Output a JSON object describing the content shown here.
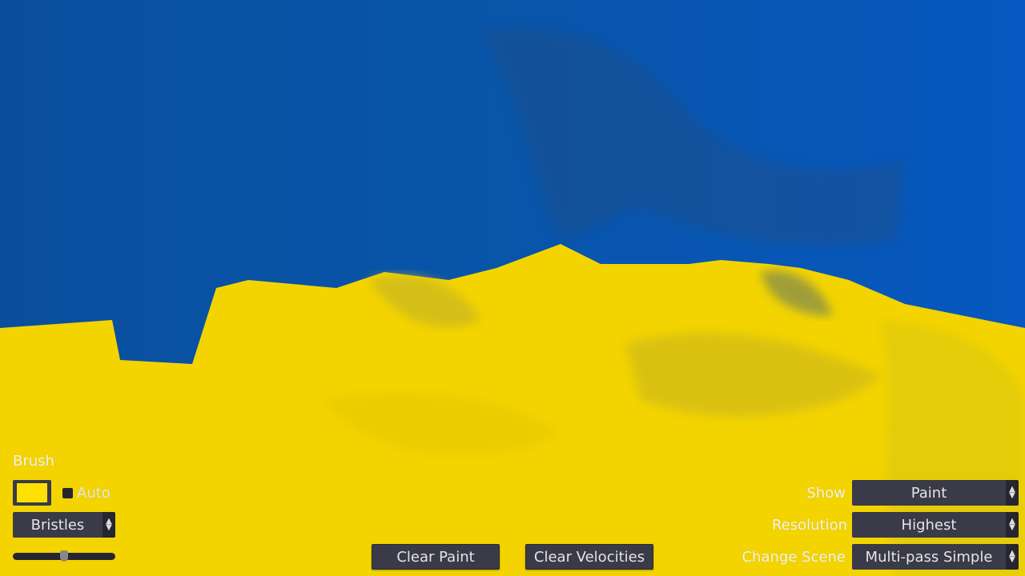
{
  "colors": {
    "paint_blue": "#0852a8",
    "paint_yellow": "#f5d800",
    "brush_color": "#ffe000",
    "control_bg": "#3a3a48"
  },
  "brush": {
    "title": "Brush",
    "auto_label": "Auto",
    "auto_checked": false,
    "type": "Bristles",
    "size_fraction": 0.5
  },
  "buttons": {
    "clear_paint": "Clear Paint",
    "clear_velocities": "Clear Velocities"
  },
  "settings": [
    {
      "label": "Show",
      "value": "Paint"
    },
    {
      "label": "Resolution",
      "value": "Highest"
    },
    {
      "label": "Change Scene",
      "value": "Multi-pass Simple"
    }
  ]
}
